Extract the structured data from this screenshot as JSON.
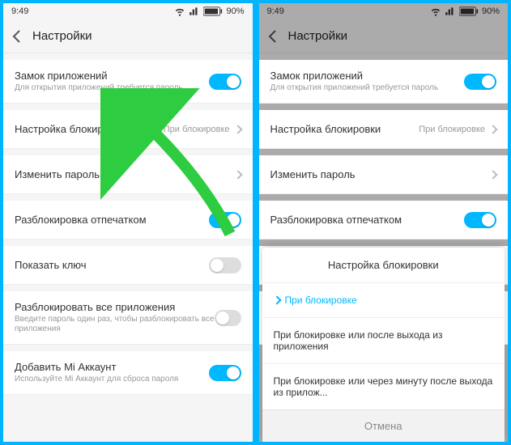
{
  "statusbar": {
    "time": "9:49",
    "battery": "90%"
  },
  "header": {
    "title": "Настройки"
  },
  "rows": {
    "appLock": {
      "label": "Замок приложений",
      "sub": "Для открытия приложений требуется пароль",
      "on": true
    },
    "lockSetting": {
      "label": "Настройка блокировки",
      "value": "При блокировке"
    },
    "changePwd": {
      "label": "Изменить пароль"
    },
    "fingerprint": {
      "label": "Разблокировка отпечатком",
      "on": true
    },
    "showKey": {
      "label": "Показать ключ",
      "on": false
    },
    "unlockAll": {
      "label": "Разблокировать все приложения",
      "sub": "Введите пароль один раз, чтобы разблокировать все приложения",
      "on": false
    },
    "miAccount": {
      "label": "Добавить Mi Аккаунт",
      "sub": "Используйте Mi Аккаунт для сброса пароля",
      "on": true
    }
  },
  "sheet": {
    "title": "Настройка блокировки",
    "opt1": "При блокировке",
    "opt2": "При блокировке или после выхода из приложения",
    "opt3": "При блокировке или через минуту после выхода из прилож...",
    "cancel": "Отмена"
  }
}
